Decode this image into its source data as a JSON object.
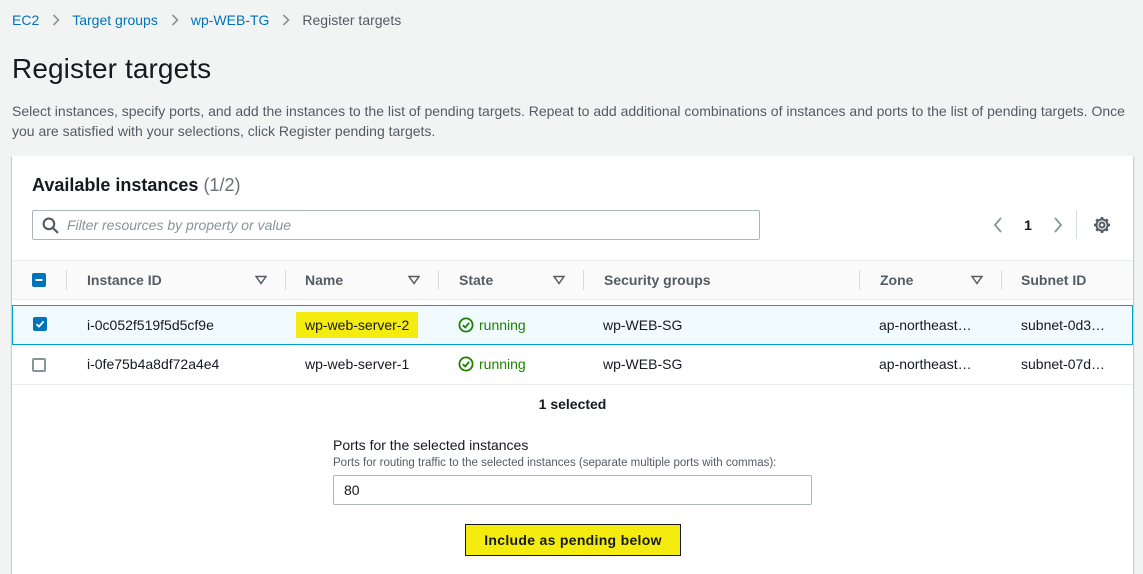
{
  "breadcrumb": {
    "items": [
      "EC2",
      "Target groups",
      "wp-WEB-TG"
    ],
    "current": "Register targets"
  },
  "page": {
    "title": "Register targets",
    "description": "Select instances, specify ports, and add the instances to the list of pending targets. Repeat to add additional combinations of instances and ports to the list of pending targets. Once you are satisfied with your selections, click Register pending targets."
  },
  "instances": {
    "title": "Available instances",
    "count": "(1/2)",
    "filter_placeholder": "Filter resources by property or value",
    "page_number": "1",
    "columns": [
      "Instance ID",
      "Name",
      "State",
      "Security groups",
      "Zone",
      "Subnet ID"
    ],
    "rows": [
      {
        "selected": true,
        "instance_id": "i-0c052f519f5d5cf9e",
        "name": "wp-web-server-2",
        "state": "running",
        "security_group": "wp-WEB-SG",
        "zone": "ap-northeast…",
        "subnet": "subnet-0d3…"
      },
      {
        "selected": false,
        "instance_id": "i-0fe75b4a8df72a4e4",
        "name": "wp-web-server-1",
        "state": "running",
        "security_group": "wp-WEB-SG",
        "zone": "ap-northeast…",
        "subnet": "subnet-07d…"
      }
    ],
    "selected_note": "1 selected"
  },
  "ports": {
    "label": "Ports for the selected instances",
    "hint": "Ports for routing traffic to the selected instances (separate multiple ports with commas):",
    "value": "80"
  },
  "actions": {
    "include_label": "Include as pending below"
  },
  "colors": {
    "link": "#0073bb",
    "highlight": "#f5ec0f",
    "running": "#1d8102",
    "selected_row_bg": "#f1faff",
    "selected_row_border": "#00a1c9"
  }
}
